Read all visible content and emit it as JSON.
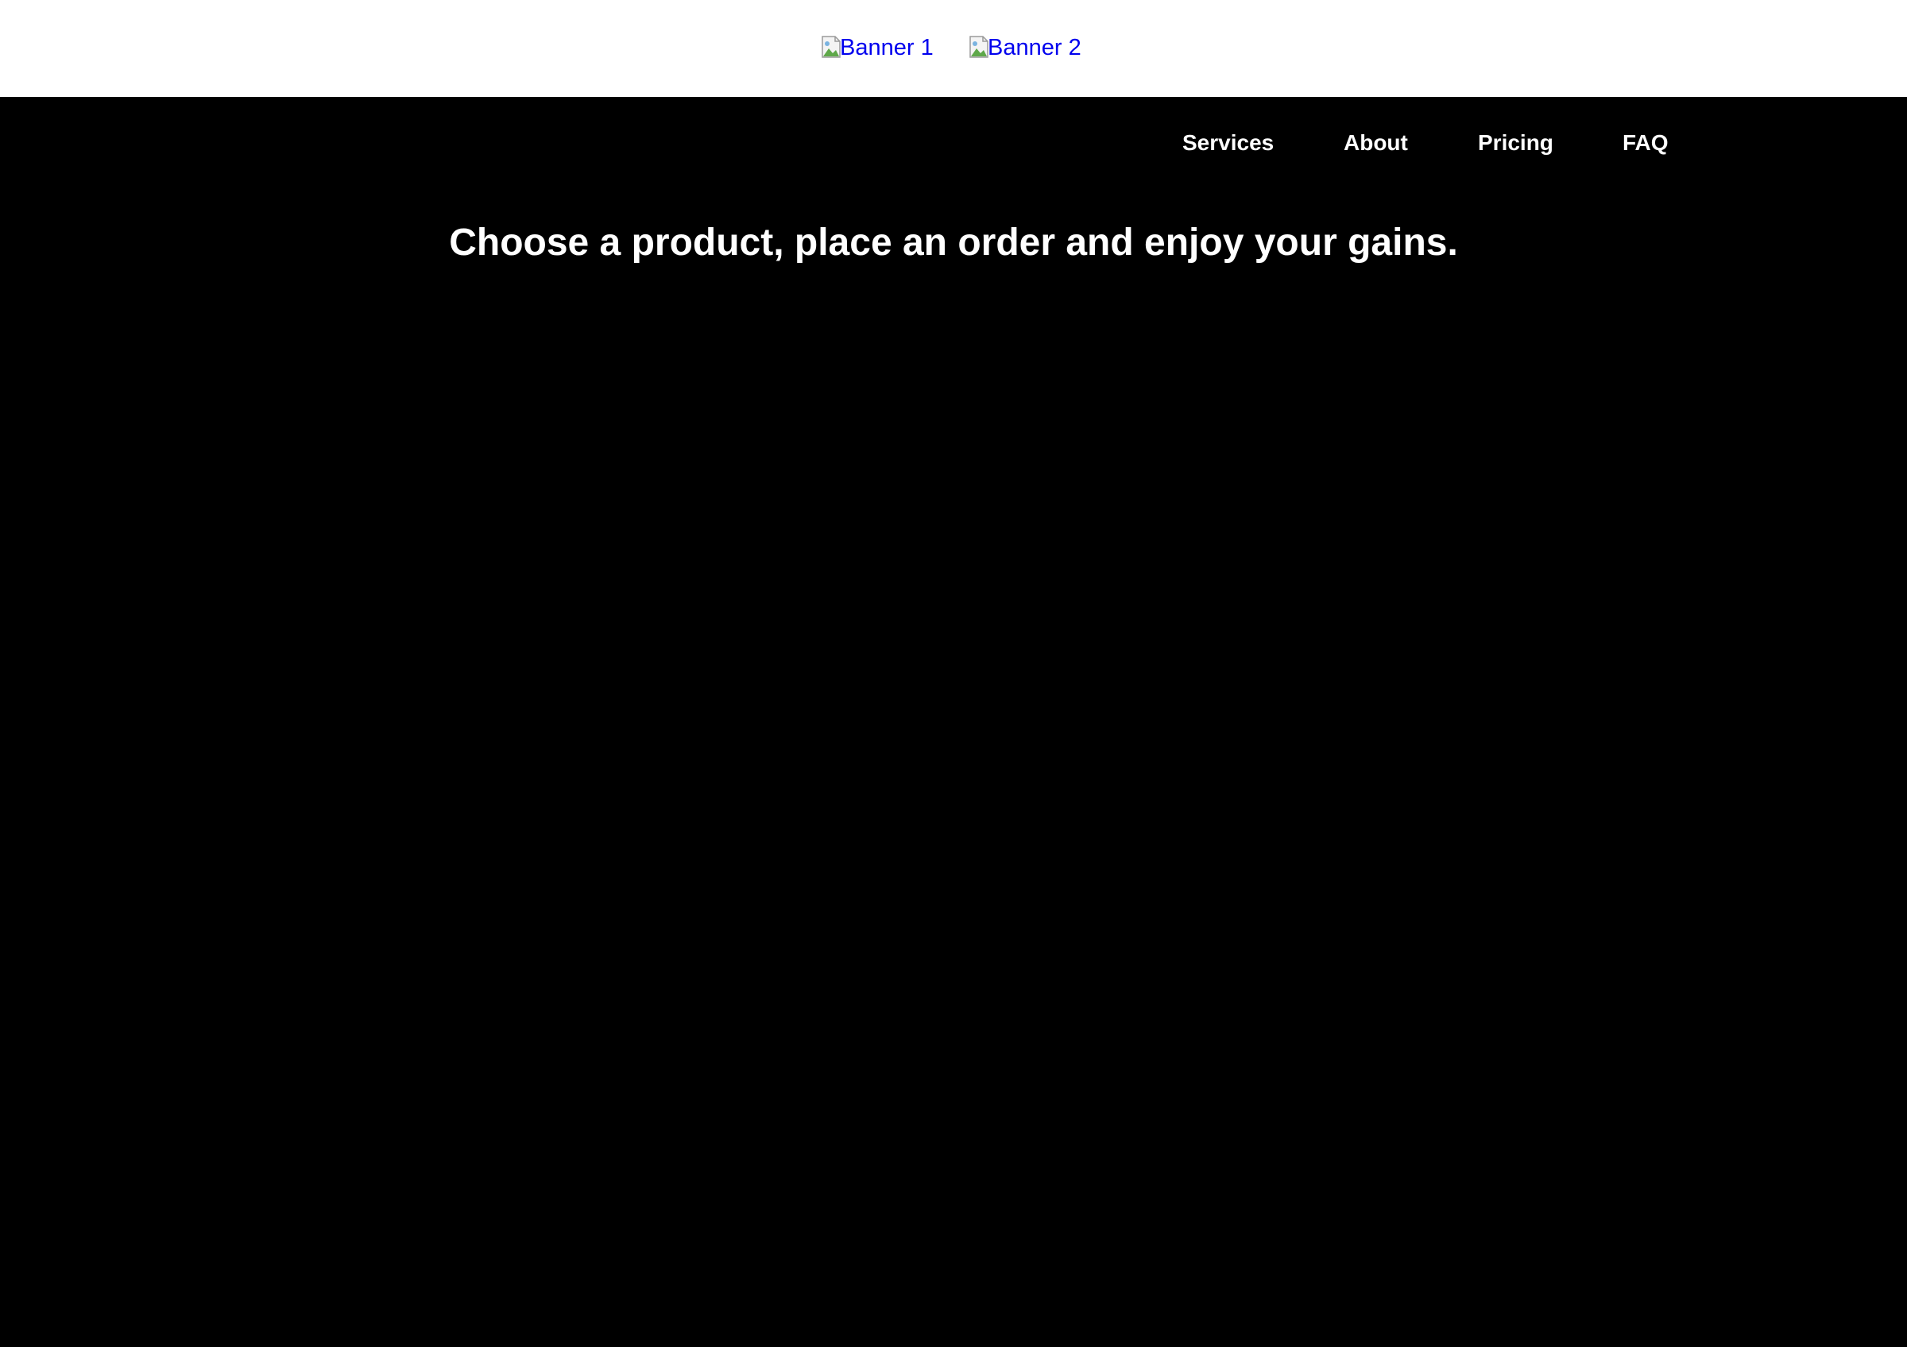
{
  "banners": [
    {
      "alt": "Banner 1",
      "link_color": "#0000ee"
    },
    {
      "alt": "Banner 2",
      "link_color": "#0000ee"
    }
  ],
  "nav": {
    "items": [
      {
        "label": "Services"
      },
      {
        "label": "About"
      },
      {
        "label": "Pricing"
      },
      {
        "label": "FAQ"
      }
    ]
  },
  "hero": {
    "headline": "Choose a product, place an order and enjoy your gains."
  },
  "colors": {
    "page_background": "#000000",
    "banner_background": "#ffffff",
    "nav_text": "#ffffff",
    "link": "#0000ee"
  }
}
